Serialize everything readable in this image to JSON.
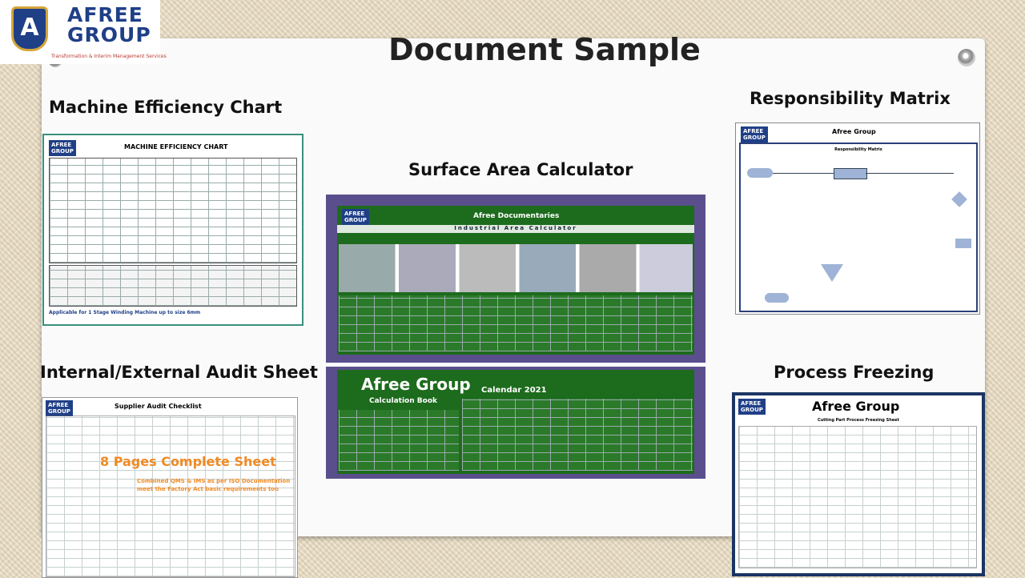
{
  "title": "Document Sample",
  "logo": {
    "name_line1": "AFREE",
    "name_line2": "GROUP",
    "tagline": "Transformation & Interim Management Services",
    "mark": "A"
  },
  "sections": {
    "machine_efficiency": {
      "heading": "Machine Efficiency Chart",
      "doc_title": "MACHINE EFFICIENCY CHART",
      "footer_note": "Applicable for 1 Stage Winding Machine up to size 6mm"
    },
    "surface_area": {
      "heading": "Surface Area Calculator",
      "banner": "Afree Documentaries",
      "subtitle": "Industrial Area Calculator",
      "calc_book": "Calculation Book",
      "brand": "Afree Group",
      "calendar": "Calendar 2021"
    },
    "responsibility": {
      "heading": "Responsibility Matrix",
      "doc_title": "Afree Group",
      "chart_title": "Responsibility Matrix"
    },
    "audit": {
      "heading": "Internal/External Audit Sheet",
      "doc_title": "Supplier Audit Checklist",
      "highlight": "8 Pages Complete Sheet",
      "note_line1": "Combined QMS & IMS as per ISO Documentation",
      "note_line2": "meet the Factory Act basic requirements too"
    },
    "process_freezing": {
      "heading": "Process Freezing",
      "doc_title": "Afree Group",
      "subtitle": "Cutting Part Process Freezing Sheet"
    }
  },
  "colors": {
    "brand_blue": "#1f3f87",
    "calc_green": "#1d6b1d",
    "calc_frame": "#5a4f8c",
    "highlight_orange": "#f08a24"
  }
}
